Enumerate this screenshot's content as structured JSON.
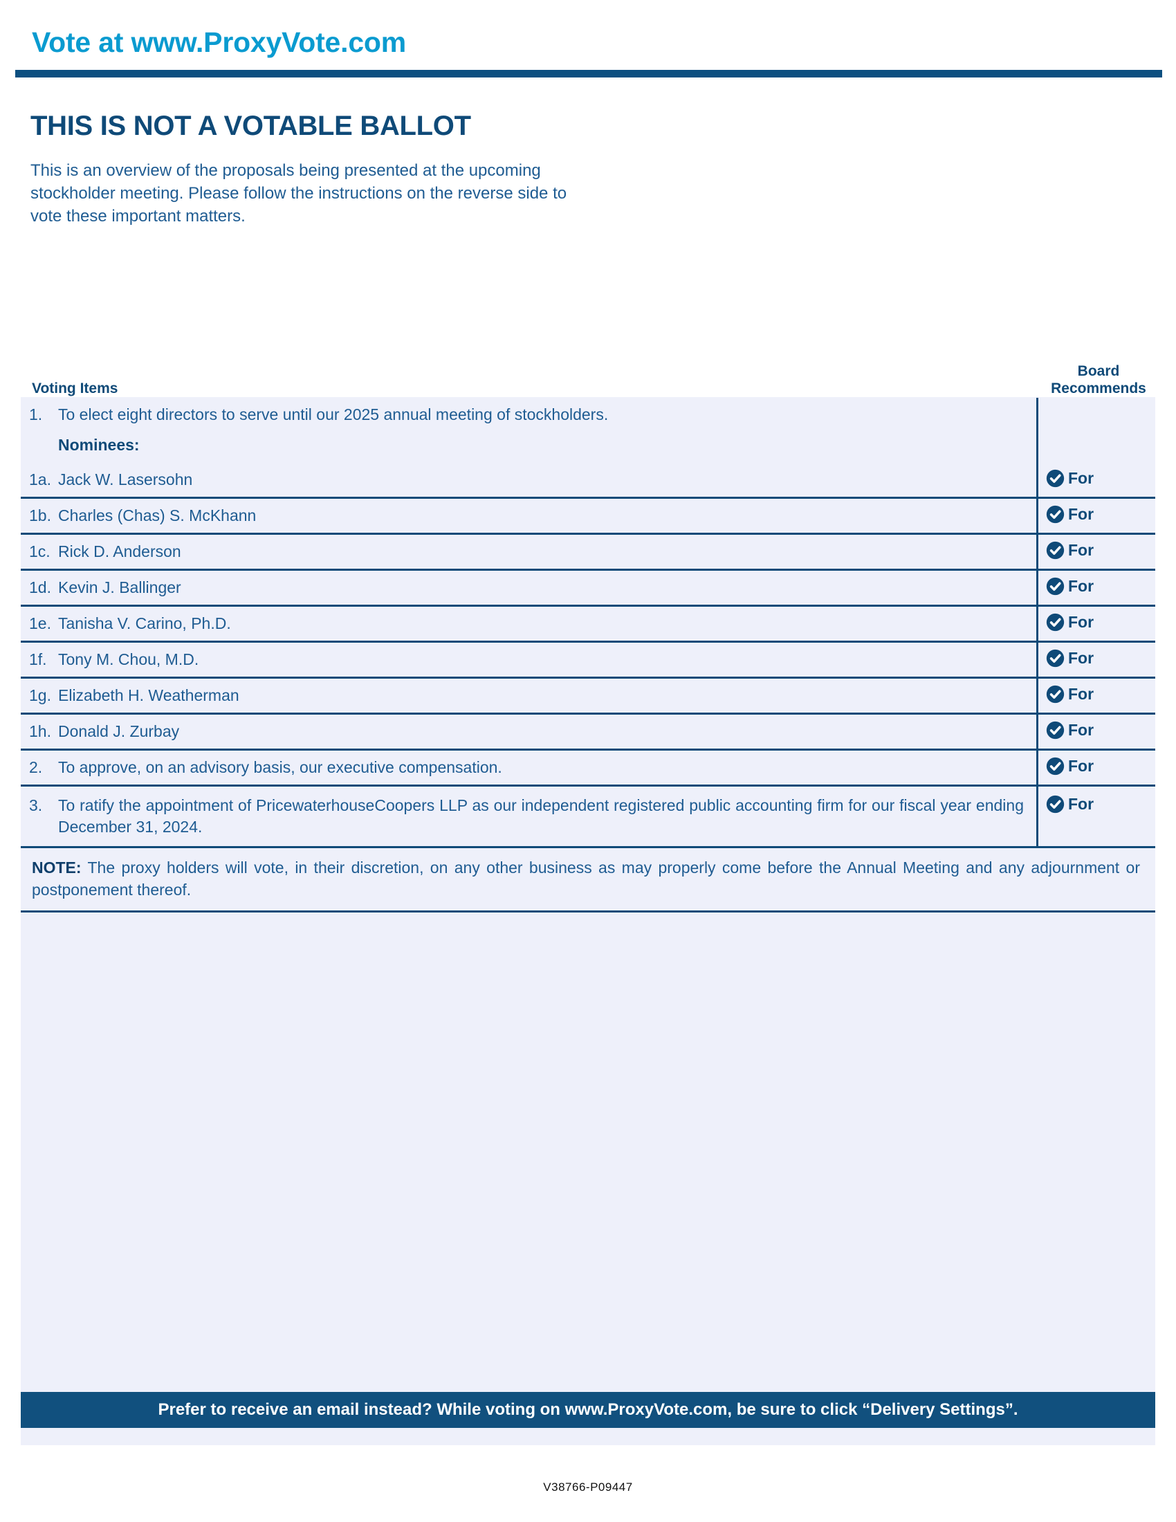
{
  "header": {
    "title": "Vote at www.ProxyVote.com"
  },
  "intro": {
    "title": "THIS IS NOT A VOTABLE BALLOT",
    "body": "This is an overview of the proposals being presented at the upcoming stockholder meeting. Please follow the instructions on the reverse side to vote these important matters."
  },
  "table": {
    "col_items_header": "Voting Items",
    "col_board_header_line1": "Board",
    "col_board_header_line2": "Recommends",
    "nominees_label": "Nominees:",
    "recommend_label": "For",
    "proposal_1": {
      "number": "1.",
      "text": "To elect eight directors to serve until our 2025 annual meeting of stockholders."
    },
    "nominees": [
      {
        "number": "1a.",
        "name": "Jack W. Lasersohn",
        "recommendation": "For"
      },
      {
        "number": "1b.",
        "name": "Charles (Chas) S. McKhann",
        "recommendation": "For"
      },
      {
        "number": "1c.",
        "name": "Rick D. Anderson",
        "recommendation": "For"
      },
      {
        "number": "1d.",
        "name": "Kevin J. Ballinger",
        "recommendation": "For"
      },
      {
        "number": "1e.",
        "name": "Tanisha V. Carino, Ph.D.",
        "recommendation": "For"
      },
      {
        "number": "1f.",
        "name": "Tony M. Chou, M.D.",
        "recommendation": "For"
      },
      {
        "number": "1g.",
        "name": "Elizabeth H. Weatherman",
        "recommendation": "For"
      },
      {
        "number": "1h.",
        "name": "Donald J. Zurbay",
        "recommendation": "For"
      }
    ],
    "proposals": [
      {
        "number": "2.",
        "text": "To approve, on an advisory basis, our executive compensation.",
        "recommendation": "For"
      },
      {
        "number": "3.",
        "text": "To ratify the appointment of PricewaterhouseCoopers LLP as our independent registered public accounting firm for our fiscal year ending December 31, 2024.",
        "recommendation": "For"
      }
    ],
    "note": {
      "label": "NOTE:",
      "text": "The proxy holders will vote, in their discretion, on any other business as may properly come before the Annual Meeting and any adjournment or postponement thereof."
    }
  },
  "footer": {
    "text": "Prefer to receive an email instead? While voting on www.ProxyVote.com, be sure to click “Delivery Settings”.",
    "control_number": "V38766-P09447"
  },
  "colors": {
    "header_cyan": "#0a9bd0",
    "navy": "#0f4a78",
    "rule_navy": "#0c4f80",
    "body_blue": "#1f5c92",
    "table_tint": "#eef0fa",
    "footer_bar": "#11507e"
  },
  "icons": {
    "check_badge": "check-circle-icon"
  }
}
